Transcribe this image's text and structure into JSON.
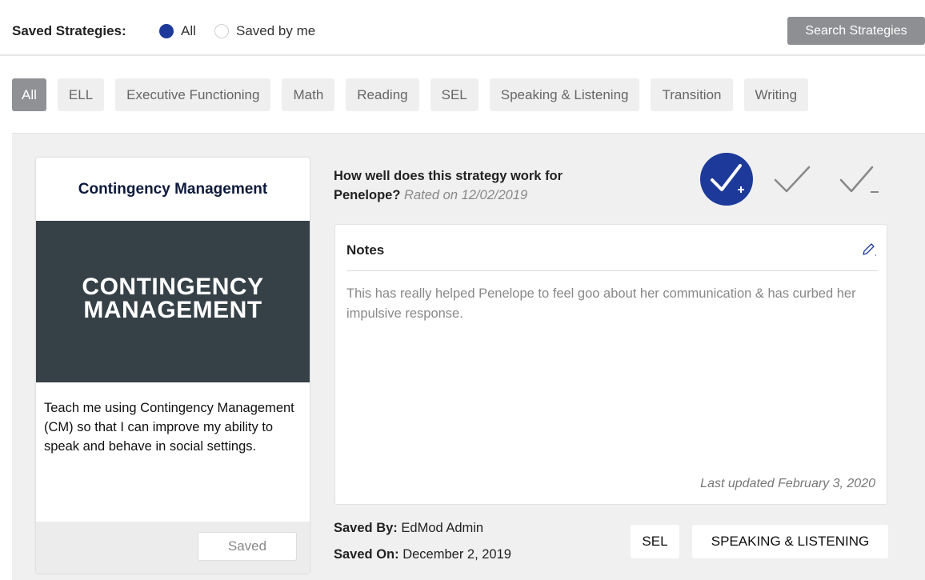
{
  "header": {
    "label": "Saved Strategies:",
    "radio_all": "All",
    "radio_saved_by_me": "Saved by me",
    "search_button": "Search Strategies"
  },
  "filters": [
    "All",
    "ELL",
    "Executive Functioning",
    "Math",
    "Reading",
    "SEL",
    "Speaking & Listening",
    "Transition",
    "Writing"
  ],
  "card": {
    "title": "Contingency Management",
    "image_line1": "CONTINGENCY",
    "image_line2": "MANAGEMENT",
    "description": "Teach me using Contingency Management (CM) so that I can improve my ability to speak and behave in social settings.",
    "saved_button": "Saved"
  },
  "question": {
    "line1": "How well does this strategy work for",
    "name": "Penelope?",
    "rated": "Rated on 12/02/2019"
  },
  "ratings": {
    "selected": "check-plus-icon",
    "options": [
      "check-plus-icon",
      "check-icon",
      "check-minus-icon"
    ]
  },
  "notes": {
    "title": "Notes",
    "body": "This has really helped Penelope to feel goo about her communication & has curbed her impulsive response.",
    "updated": "Last updated February 3, 2020"
  },
  "meta": {
    "saved_by_label": "Saved By:",
    "saved_by_value": "EdMod Admin",
    "saved_on_label": "Saved On:",
    "saved_on_value": "December 2, 2019"
  },
  "tags": [
    "SEL",
    "SPEAKING & LISTENING"
  ],
  "colors": {
    "accent": "#1d3a9a",
    "image_bg": "#364047",
    "chip_active": "#8f9194"
  }
}
